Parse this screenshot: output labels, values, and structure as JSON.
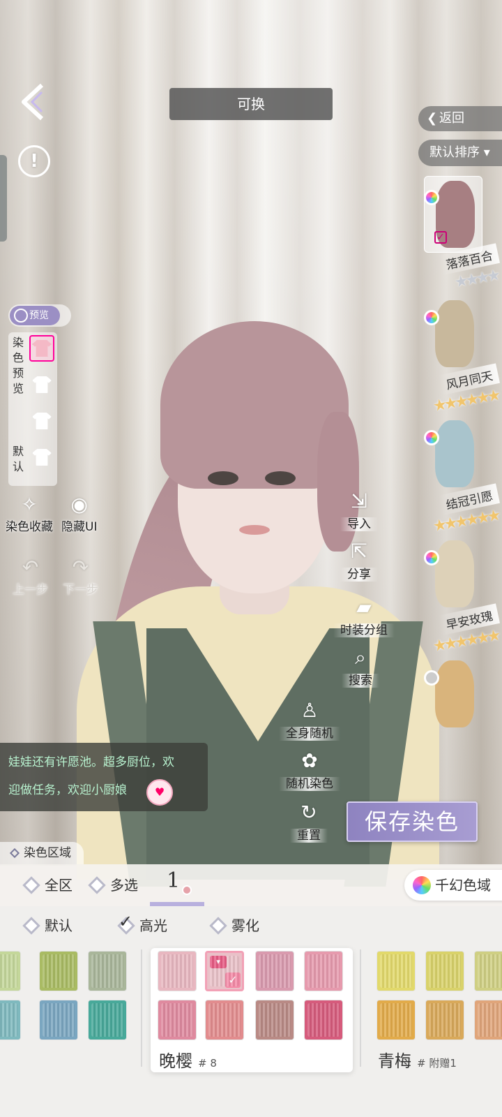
{
  "title_bar": {
    "label": "可换"
  },
  "nav": {
    "return_label": "返回",
    "sort_label": "默认排序 ▾"
  },
  "hairstyles": [
    {
      "name": "落落百合",
      "stars": "★★★★",
      "tier": "silver",
      "selected": true,
      "color": "#a77f82"
    },
    {
      "name": "风月同天",
      "stars": "★★★★★★",
      "tier": "gold",
      "selected": false,
      "color": "#c8b89c"
    },
    {
      "name": "结冠引愿",
      "stars": "★★★★★★",
      "tier": "gold",
      "selected": false,
      "color": "#a9c4cc"
    },
    {
      "name": "早安玫瑰",
      "stars": "★★★★★★",
      "tier": "gold",
      "selected": false,
      "color": "#ddd1b8"
    },
    {
      "name": "",
      "stars": "",
      "tier": "gold",
      "selected": false,
      "color": "#d9b47c"
    }
  ],
  "left_panel": {
    "preview_label": "预览",
    "dye_preview_label": "染色预览",
    "default_label": "默认",
    "favorite_label": "染色收藏",
    "hide_ui_label": "隐藏UI",
    "undo_label": "上一步",
    "redo_label": "下一步"
  },
  "actions": {
    "import_label": "导入",
    "share_label": "分享",
    "group_label": "时装分组",
    "search_label": "搜索",
    "random_body_label": "全身随机",
    "random_dye_label": "随机染色",
    "reset_label": "重置",
    "save_label": "保存染色"
  },
  "chat": {
    "line1": "娃娃还有许愿池。超多厨位，欢",
    "line2": "迎做任务，欢迎小厨娘"
  },
  "bottom": {
    "area_tab_label": "染色区域",
    "zone_all": "全区",
    "zone_multi": "多选",
    "count": "1",
    "magic_label": "千幻色域",
    "mode_default": "默认",
    "mode_highlight": "高光",
    "mode_mist": "雾化"
  },
  "palettes": {
    "left": {
      "colors": [
        "#c4d79a",
        "#a9bb63",
        "#a9b69a",
        "#7fb9be",
        "#7aa6c0",
        "#48a99a"
      ]
    },
    "center": {
      "name": "晚樱",
      "number": "# 8",
      "colors": [
        "#e8b7c0",
        "#e9c1c8",
        "#d99aae",
        "#e69aad",
        "#df8a9f",
        "#e28c8e",
        "#b98a85",
        "#d65b7c"
      ],
      "selected_index": 1
    },
    "right": {
      "name": "青梅",
      "number": "# 附赠1",
      "colors": [
        "#e2d96b",
        "#d9d26a",
        "#cfcf83",
        "#e2ab4a",
        "#d9a95a",
        "#e0a57a"
      ]
    }
  }
}
